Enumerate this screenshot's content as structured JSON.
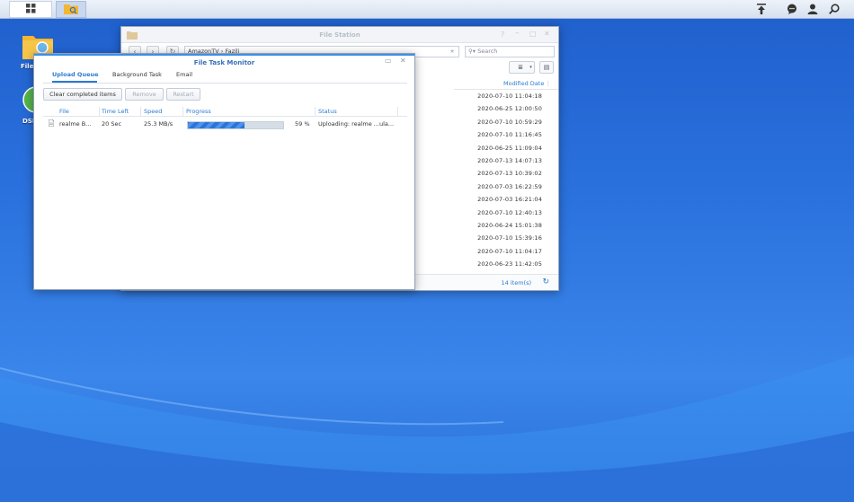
{
  "desktop": {
    "icons": [
      {
        "label": "File"
      },
      {
        "label": "DSM"
      }
    ]
  },
  "file_station": {
    "title": "File Station",
    "path": [
      "AmazonTV",
      "Fazili"
    ],
    "search_placeholder": "Search",
    "column_header": "Modified Date",
    "modified_dates": [
      "2020-07-10 11:04:18",
      "2020-06-25 12:00:50",
      "2020-07-10 10:59:29",
      "2020-07-10 11:16:45",
      "2020-06-25 11:09:04",
      "2020-07-13 14:07:13",
      "2020-07-13 10:39:02",
      "2020-07-03 16:22:59",
      "2020-07-03 16:21:04",
      "2020-07-10 12:40:13",
      "2020-06-24 15:01:38",
      "2020-07-10 15:39:16",
      "2020-07-10 11:04:17",
      "2020-06-23 11:42:05"
    ],
    "item_count": "14 item(s)"
  },
  "task_monitor": {
    "title": "File Task Monitor",
    "tabs": [
      {
        "label": "Upload Queue",
        "active": true
      },
      {
        "label": "Background Task",
        "active": false
      },
      {
        "label": "Email",
        "active": false
      }
    ],
    "buttons": {
      "clear": "Clear completed items",
      "remove": "Remove",
      "restart": "Restart"
    },
    "columns": {
      "file": "File",
      "time_left": "Time Left",
      "speed": "Speed",
      "progress": "Progress",
      "status": "Status"
    },
    "rows": [
      {
        "file": "realme B...",
        "time_left": "20 Sec",
        "speed": "25.3 MB/s",
        "progress_text": "59 %",
        "progress_fraction": 0.59,
        "status": "Uploading: realme ...ula..."
      }
    ]
  },
  "colors": {
    "accent": "#2a7bd1",
    "desktop": "#2f6fd6"
  }
}
